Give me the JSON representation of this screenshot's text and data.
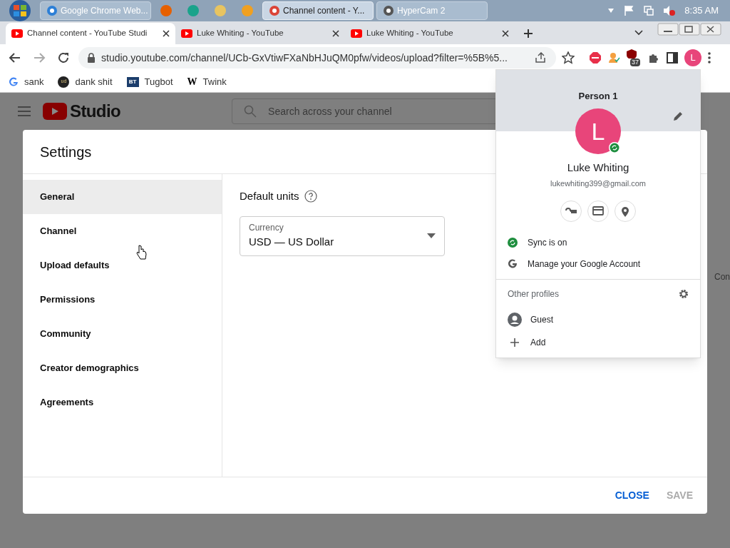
{
  "taskbar": {
    "items": [
      {
        "kind": "window",
        "label": "Google Chrome Web...",
        "selected": false
      },
      {
        "kind": "firefox"
      },
      {
        "kind": "green"
      },
      {
        "kind": "folder"
      },
      {
        "kind": "media"
      },
      {
        "kind": "window",
        "label": "Channel content - Y...",
        "selected": true
      },
      {
        "kind": "window",
        "label": "HyperCam 2",
        "selected": false
      }
    ],
    "clock": "8:35 AM"
  },
  "tabs": [
    {
      "title": "Channel content - YouTube Studi",
      "selected": true
    },
    {
      "title": "Luke Whiting - YouTube",
      "selected": false
    },
    {
      "title": "Luke Whiting - YouTube",
      "selected": false
    }
  ],
  "address_bar": {
    "url": "studio.youtube.com/channel/UCb-GxVtiwFXaNbHJuQM0pfw/videos/upload?filter=%5B%5...",
    "extension_badge": "37",
    "avatar_letter": "L"
  },
  "bookmarks": [
    {
      "kind": "google",
      "label": "sank"
    },
    {
      "kind": "circle",
      "mark": "ud",
      "label": "dank shit"
    },
    {
      "kind": "square",
      "mark": "BT",
      "label": "Tugbot"
    },
    {
      "kind": "letter",
      "mark": "W",
      "label": "Twink"
    }
  ],
  "studio": {
    "logo": "Studio",
    "search_placeholder": "Search across your channel",
    "cut_text": "Con"
  },
  "settings": {
    "title": "Settings",
    "nav": [
      {
        "label": "General",
        "selected": true
      },
      {
        "label": "Channel",
        "selected": false
      },
      {
        "label": "Upload defaults",
        "selected": false
      },
      {
        "label": "Permissions",
        "selected": false
      },
      {
        "label": "Community",
        "selected": false
      },
      {
        "label": "Creator demographics",
        "selected": false
      },
      {
        "label": "Agreements",
        "selected": false
      }
    ],
    "heading": "Default units",
    "select_label": "Currency",
    "select_value": "USD — US Dollar",
    "buttons": [
      {
        "label": "CLOSE",
        "disabled": false
      },
      {
        "label": "SAVE",
        "disabled": true
      }
    ]
  },
  "profile": {
    "header": "Person 1",
    "avatar_letter": "L",
    "name": "Luke Whiting",
    "email": "lukewhiting399@gmail.com",
    "actions": [
      {
        "kind": "sync",
        "label": "Sync is on"
      },
      {
        "kind": "google",
        "label": "Manage your Google Account"
      }
    ],
    "other_profiles": "Other profiles",
    "profiles": [
      {
        "kind": "guest",
        "label": "Guest"
      },
      {
        "kind": "add",
        "label": "Add"
      }
    ]
  }
}
